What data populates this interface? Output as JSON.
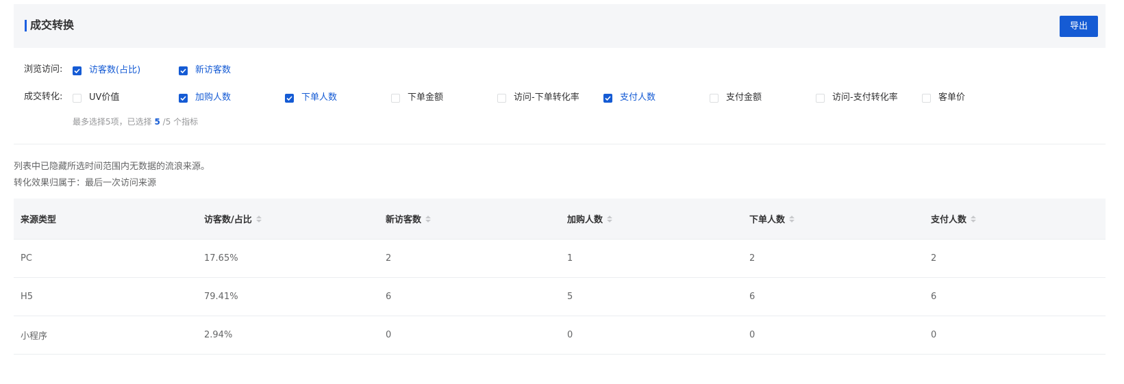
{
  "header": {
    "title": "成交转换",
    "export_label": "导出"
  },
  "filters": {
    "browse": {
      "label": "浏览访问:",
      "options": [
        {
          "label": "访客数(占比)",
          "checked": true
        },
        {
          "label": "新访客数",
          "checked": true
        }
      ]
    },
    "conversion": {
      "label": "成交转化:",
      "options": [
        {
          "label": "UV价值",
          "checked": false
        },
        {
          "label": "加购人数",
          "checked": true
        },
        {
          "label": "下单人数",
          "checked": true
        },
        {
          "label": "下单金额",
          "checked": false
        },
        {
          "label": "访问-下单转化率",
          "checked": false
        },
        {
          "label": "支付人数",
          "checked": true
        },
        {
          "label": "支付金额",
          "checked": false
        },
        {
          "label": "访问-支付转化率",
          "checked": false
        },
        {
          "label": "客单价",
          "checked": false
        }
      ]
    },
    "hint": {
      "prefix": "最多选择5项，已选择",
      "selected": "5",
      "suffix": "/5 个指标"
    }
  },
  "notes": {
    "line1": "列表中已隐藏所选时间范围内无数据的流浪来源。",
    "line2": "转化效果归属于：最后一次访问来源"
  },
  "table": {
    "columns": [
      "来源类型",
      "访客数/占比",
      "新访客数",
      "加购人数",
      "下单人数",
      "支付人数"
    ],
    "rows": [
      [
        "PC",
        "17.65%",
        "2",
        "1",
        "2",
        "2"
      ],
      [
        "H5",
        "79.41%",
        "6",
        "5",
        "6",
        "6"
      ],
      [
        "小程序",
        "2.94%",
        "0",
        "0",
        "0",
        "0"
      ]
    ]
  },
  "colors": {
    "accent": "#155bd4",
    "header_bg": "#f5f6f8"
  }
}
